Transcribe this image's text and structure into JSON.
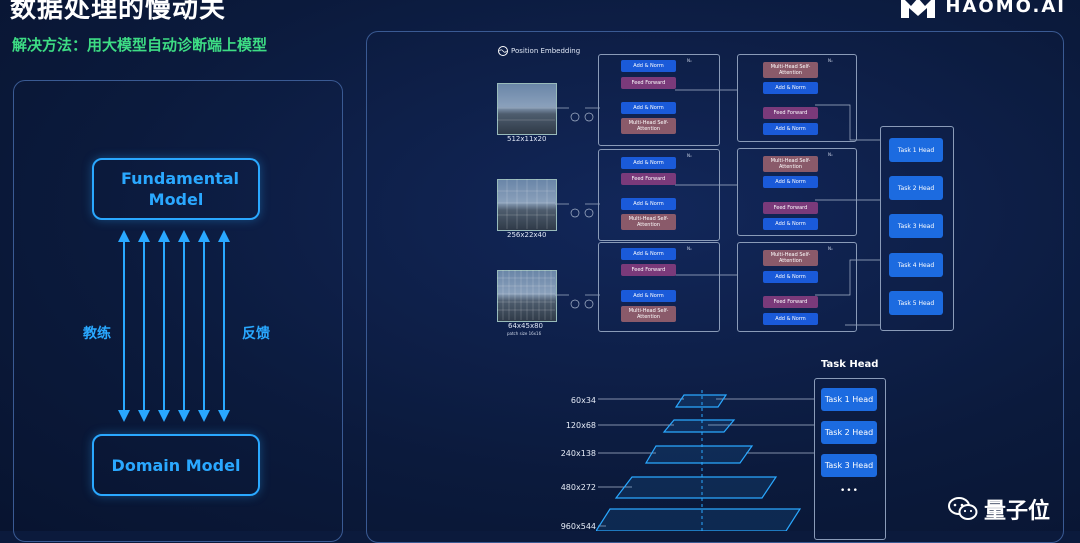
{
  "header": {
    "title": "数据处理的慢动关",
    "subtitle": "解决方法：用大模型自动诊断端上模型",
    "logo_text": "HAOMO.AI"
  },
  "left_panel": {
    "top_box": "Fundamental Model",
    "bottom_box": "Domain Model",
    "left_label": "教练",
    "right_label": "反馈"
  },
  "diagram": {
    "position_embedding": "Position Embedding",
    "inputs": [
      {
        "size": "512x11x20",
        "note": ""
      },
      {
        "size": "256x22x40",
        "note": ""
      },
      {
        "size": "64x45x80",
        "note": "patch size 16x16"
      }
    ],
    "nx": "Nₓ",
    "add_norm": "Add & Norm",
    "feed_forward": "Feed Forward",
    "self_attention": "Multi-Head Self-Attention",
    "task_heads_top": [
      "Task 1 Head",
      "Task 2 Head",
      "Task 3 Head",
      "Task 4 Head",
      "Task 5 Head"
    ],
    "task_head_title": "Task Head",
    "pyramid_levels": [
      "60x34",
      "120x68",
      "240x138",
      "480x272",
      "960x544"
    ],
    "task_heads_bottom": [
      "Task 1 Head",
      "Task 2 Head",
      "Task 3 Head"
    ],
    "ellipsis": "•••"
  },
  "watermark": {
    "text": "量子位",
    "icon": "wechat-icon"
  },
  "colors": {
    "accent": "#2aa8ff",
    "green": "#3ddc84",
    "background": "#0b1a3c"
  }
}
